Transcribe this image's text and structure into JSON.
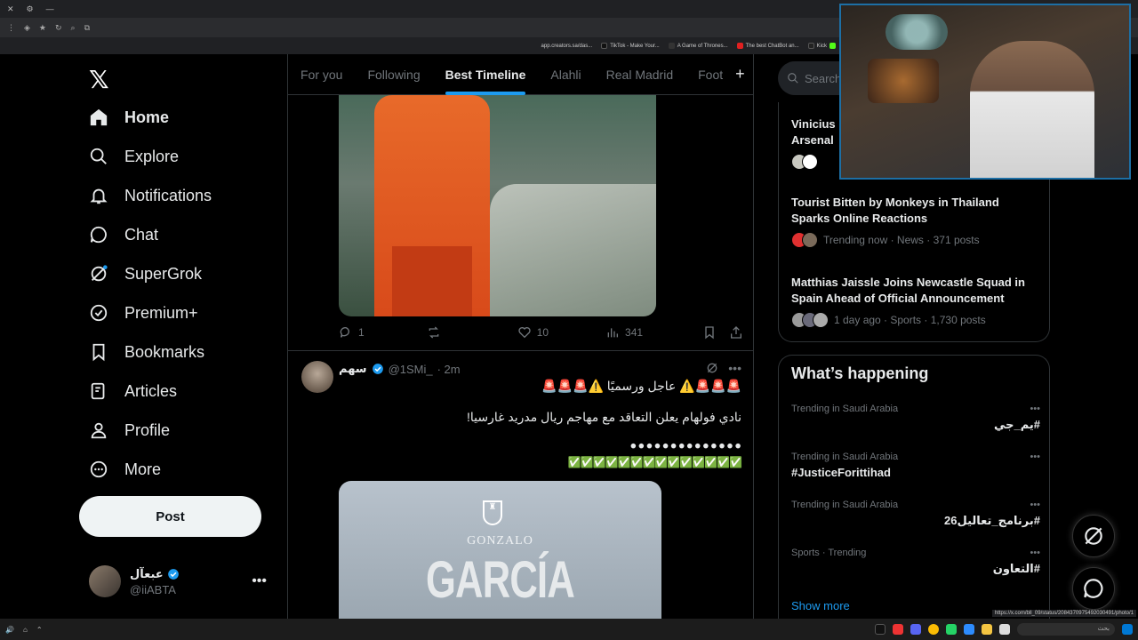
{
  "browser": {
    "bookmarks": [
      "app.creators.sa/das...",
      "TikTok - Make Your...",
      "A Game of Thrones...",
      "The best ChatBot an...",
      "Kick"
    ]
  },
  "nav": {
    "items": [
      {
        "label": "Home",
        "icon": "home-icon"
      },
      {
        "label": "Explore",
        "icon": "search-icon"
      },
      {
        "label": "Notifications",
        "icon": "bell-icon"
      },
      {
        "label": "Chat",
        "icon": "chat-icon"
      },
      {
        "label": "SuperGrok",
        "icon": "grok-icon"
      },
      {
        "label": "Premium+",
        "icon": "premium-icon"
      },
      {
        "label": "Bookmarks",
        "icon": "bookmark-icon"
      },
      {
        "label": "Articles",
        "icon": "articles-icon"
      },
      {
        "label": "Profile",
        "icon": "profile-icon"
      },
      {
        "label": "More",
        "icon": "more-icon"
      }
    ],
    "post_label": "Post",
    "profile": {
      "name": "عبعآل",
      "handle": "@iiABTA"
    }
  },
  "tabs": [
    "For you",
    "Following",
    "Best Timeline",
    "Alahli",
    "Real Madrid",
    "Foot"
  ],
  "tweet1": {
    "replies": "1",
    "likes": "10",
    "views": "341"
  },
  "tweet2": {
    "name": "سهم",
    "handle": "@1SMi_",
    "time": "· 2m",
    "line1": "🚨🚨🚨⚠️ عاجل ورسميًا ⚠️🚨🚨🚨",
    "line2": "نادي فولهام يعلن التعاقد مع مهاجم ريال مدريد غارسيا!",
    "line3": "⚫⚫⚫⚫⚫⚫⚫⚫⚫⚫⚫⚫⚫⚫",
    "line4": "✅✅✅✅✅✅✅✅✅✅✅✅✅✅",
    "media_top": "GONZALO",
    "media_main": "GARCÍA"
  },
  "search": {
    "placeholder": "Search"
  },
  "news": [
    {
      "title": "Vinicius ... Arsenal",
      "title_line1": "Vinicius",
      "title_line2": "Arsenal",
      "meta": ""
    },
    {
      "title_line1": "Tourist Bitten by Monkeys in Thailand",
      "title_line2": "Sparks Online Reactions",
      "meta": "Trending now · News · 371 posts"
    },
    {
      "title_line1": "Matthias Jaissle Joins Newcastle Squad in",
      "title_line2": "Spain Ahead of Official Announcement",
      "meta": "1 day ago · Sports · 1,730 posts"
    }
  ],
  "trends": {
    "title": "What’s happening",
    "items": [
      {
        "context": "Trending in Saudi Arabia",
        "name": "#يم_جي",
        "rtl": true
      },
      {
        "context": "Trending in Saudi Arabia",
        "name": "#JusticeForittihad",
        "rtl": false
      },
      {
        "context": "Trending in Saudi Arabia",
        "name": "#برنامج_تعاليل26",
        "rtl": true
      },
      {
        "context": "Sports · Trending",
        "name": "#التعاون",
        "rtl": true
      }
    ],
    "show_more": "Show more"
  },
  "status": {
    "url": "https://x.com/bll_09/status/2084370975492030491/photo/1",
    "taskbar_search": "بحث"
  },
  "colors": {
    "accent": "#1d9bf0",
    "bg": "#000000",
    "border": "#2f3336"
  }
}
